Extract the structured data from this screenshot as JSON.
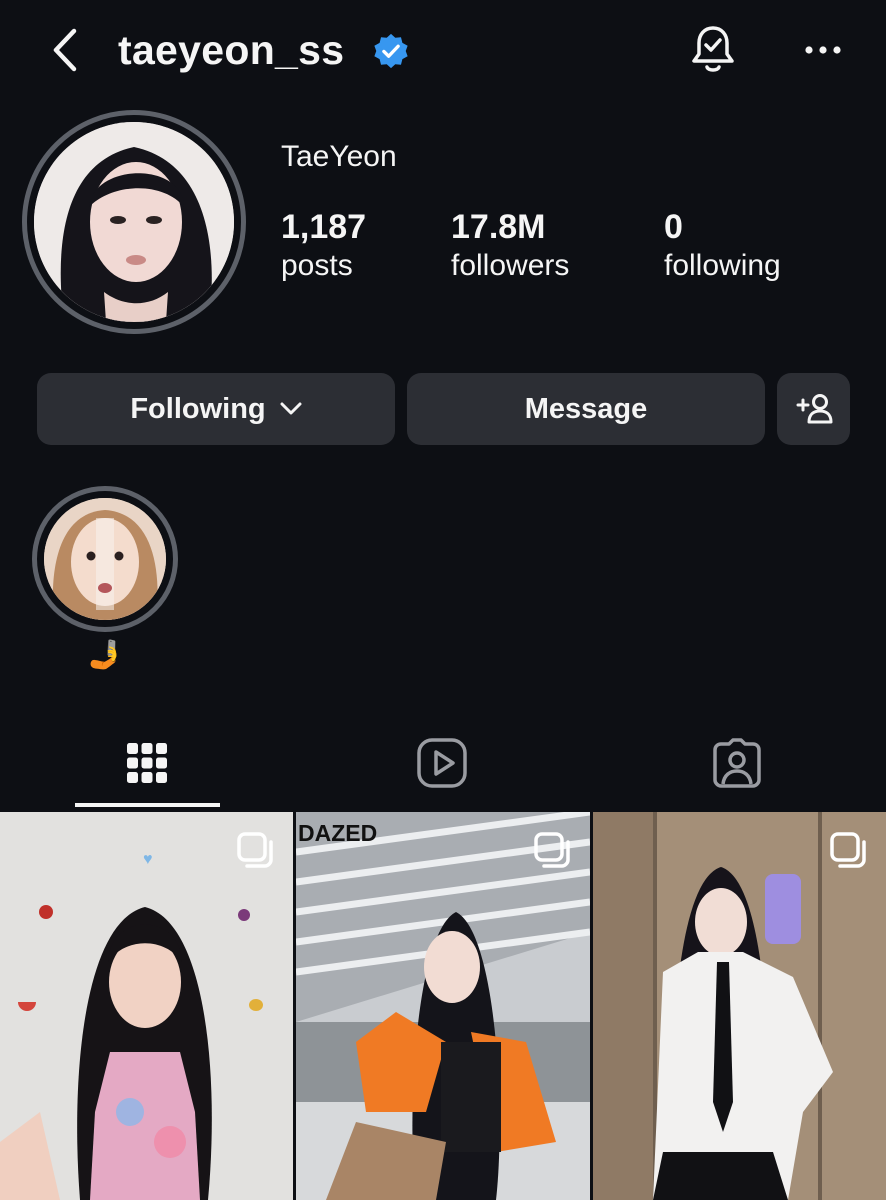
{
  "header": {
    "username": "taeyeon_ss",
    "back_icon": "chevron-left-icon",
    "verified_icon": "verified-badge-icon",
    "verified_color": "#3797f0",
    "notification_icon": "bell-check-icon",
    "more_icon": "more-horizontal-icon"
  },
  "profile": {
    "display_name": "TaeYeon",
    "stats": [
      {
        "value": "1,187",
        "label": "posts"
      },
      {
        "value": "17.8M",
        "label": "followers"
      },
      {
        "value": "0",
        "label": "following"
      }
    ]
  },
  "actions": {
    "following_label": "Following",
    "message_label": "Message",
    "add_user_icon": "add-user-icon"
  },
  "highlights": [
    {
      "label": "🤳"
    }
  ],
  "tabs": [
    {
      "icon": "grid-icon",
      "active": true
    },
    {
      "icon": "reels-icon",
      "active": false
    },
    {
      "icon": "tagged-icon",
      "active": false
    }
  ],
  "posts": [
    {
      "overlay_text": "",
      "multi": true
    },
    {
      "overlay_text": "DAZED",
      "multi": true
    },
    {
      "overlay_text": "",
      "multi": true
    }
  ],
  "colors": {
    "background": "#0d0f14",
    "button": "#2c2e34",
    "ring": "#5d6169",
    "text": "#f5f5f5"
  }
}
